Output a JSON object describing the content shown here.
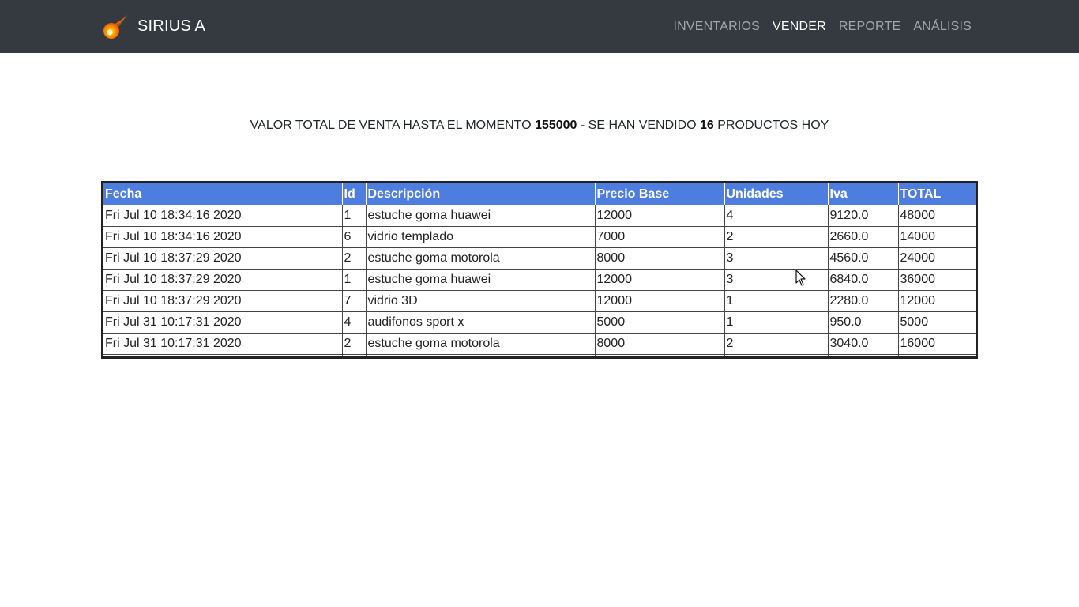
{
  "app": {
    "name": "SIRIUS A",
    "logo_icon": "comet-icon"
  },
  "nav": {
    "items": [
      {
        "label": "INVENTARIOS",
        "active": false
      },
      {
        "label": "VENDER",
        "active": true
      },
      {
        "label": "REPORTE",
        "active": false
      },
      {
        "label": "ANÁLISIS",
        "active": false
      }
    ]
  },
  "summary": {
    "prefix": "VALOR TOTAL DE VENTA HASTA EL MOMENTO ",
    "total_value": "155000",
    "middle": " - SE HAN VENDIDO ",
    "units_sold": "16",
    "suffix": " PRODUCTOS HOY"
  },
  "sales_table": {
    "columns": [
      "Fecha",
      "Id",
      "Descripción",
      "Precio Base",
      "Unidades",
      "Iva",
      "TOTAL"
    ],
    "rows": [
      [
        "Fri Jul 10 18:34:16 2020",
        "1",
        "estuche goma huawei",
        "12000",
        "4",
        "9120.0",
        "48000"
      ],
      [
        "Fri Jul 10 18:34:16 2020",
        "6",
        "vidrio templado",
        "7000",
        "2",
        "2660.0",
        "14000"
      ],
      [
        "Fri Jul 10 18:37:29 2020",
        "2",
        "estuche goma motorola",
        "8000",
        "3",
        "4560.0",
        "24000"
      ],
      [
        "Fri Jul 10 18:37:29 2020",
        "1",
        "estuche goma huawei",
        "12000",
        "3",
        "6840.0",
        "36000"
      ],
      [
        "Fri Jul 10 18:37:29 2020",
        "7",
        "vidrio 3D",
        "12000",
        "1",
        "2280.0",
        "12000"
      ],
      [
        "Fri Jul 31 10:17:31 2020",
        "4",
        "audifonos sport x",
        "5000",
        "1",
        "950.0",
        "5000"
      ],
      [
        "Fri Jul 31 10:17:31 2020",
        "2",
        "estuche goma motorola",
        "8000",
        "2",
        "3040.0",
        "16000"
      ]
    ]
  },
  "colors": {
    "navbar_bg": "#343a40",
    "table_header_bg": "#4e7de0",
    "nav_active": "#ffffff",
    "nav_inactive": "#9a9da0"
  }
}
